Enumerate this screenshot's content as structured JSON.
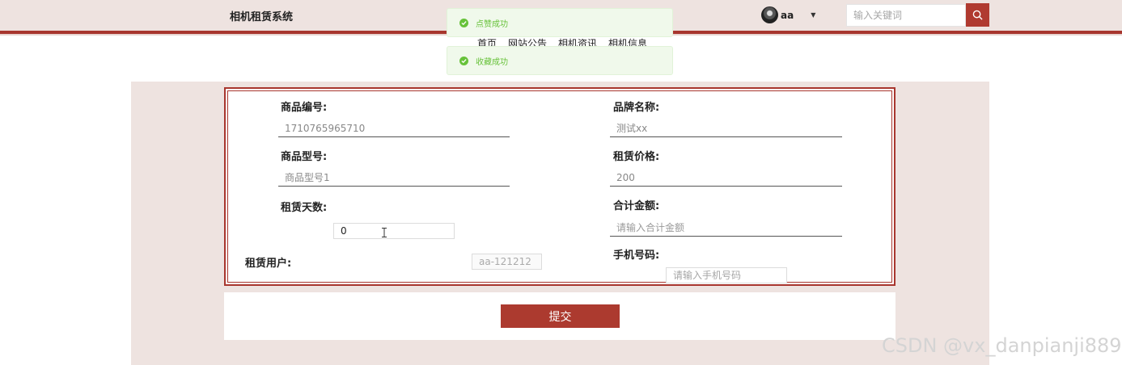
{
  "header": {
    "logo": "相机租赁系统",
    "nav": [
      "首页",
      "网站公告",
      "相机资讯",
      "相机信息"
    ],
    "user_name": "aa",
    "search_placeholder": "输入关键词"
  },
  "toasts": [
    {
      "text": "点赞成功"
    },
    {
      "text": "收藏成功"
    }
  ],
  "form": {
    "product_no_label": "商品编号:",
    "product_no_value": "1710765965710",
    "brand_label": "品牌名称:",
    "brand_value": "测试xx",
    "model_label": "商品型号:",
    "model_value": "商品型号1",
    "price_label": "租赁价格:",
    "price_value": "200",
    "days_label": "租赁天数:",
    "days_value": "0",
    "total_label": "合计金额:",
    "total_placeholder": "请输入合计金额",
    "user_label": "租赁用户:",
    "user_value": "aa-121212",
    "phone_label": "手机号码:",
    "phone_placeholder": "请输入手机号码"
  },
  "submit_label": "提交",
  "watermark": "CSDN @vx_danpianji889",
  "colors": {
    "accent": "#a8362e",
    "panel": "#eee3e0",
    "success": "#67c23a"
  }
}
